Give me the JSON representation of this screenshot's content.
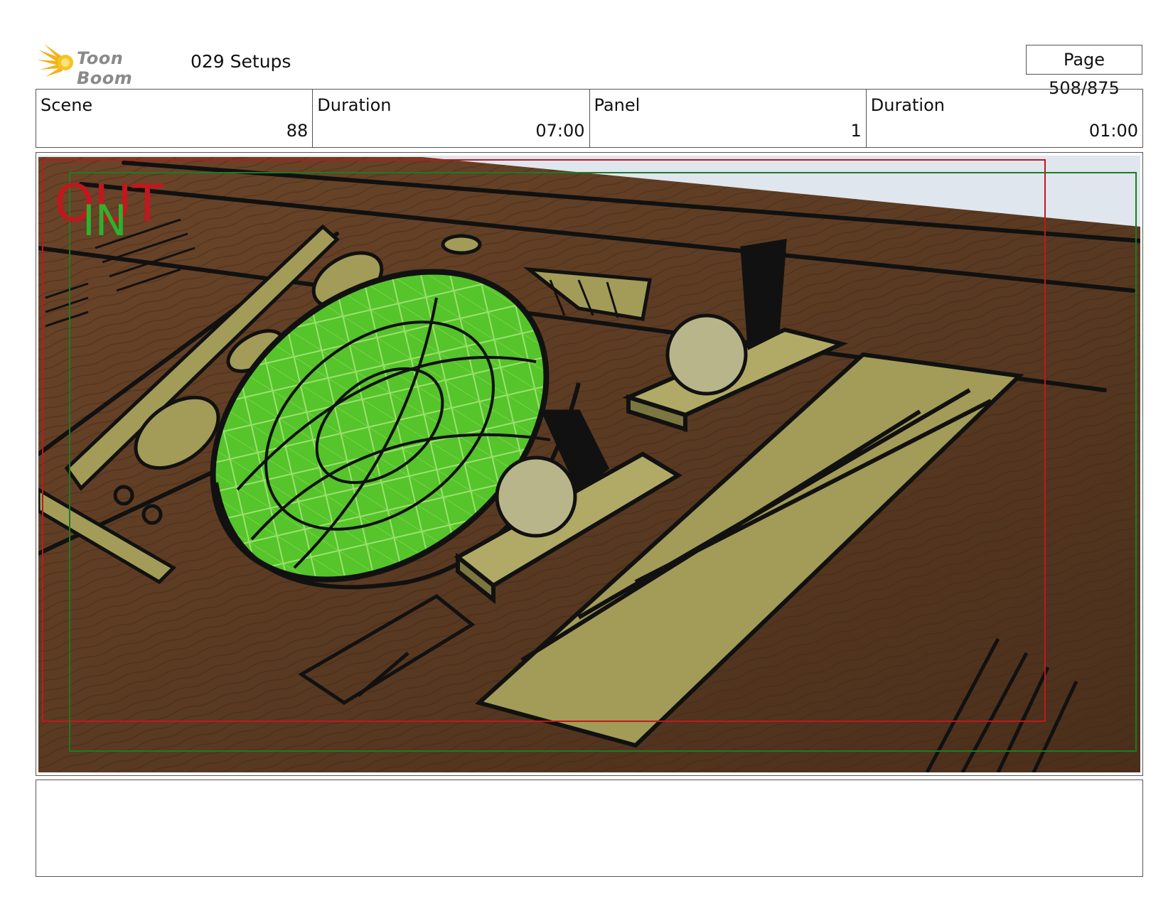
{
  "header": {
    "logo_text": "Toon Boom",
    "title": "029 Setups",
    "page": "Page 508/875"
  },
  "info": {
    "scene_label": "Scene",
    "scene_value": "88",
    "scene_duration_label": "Duration",
    "scene_duration_value": "07:00",
    "panel_label": "Panel",
    "panel_value": "1",
    "panel_duration_label": "Duration",
    "panel_duration_value": "01:00"
  },
  "panel": {
    "out_label": "OUT",
    "in_label": "IN",
    "colors": {
      "wood": "#5a3a22",
      "panel_olive": "#a09a55",
      "screen_green": "#55c22a",
      "outline": "#111111",
      "frame_out": "#c0181e",
      "frame_in": "#1e7a24"
    }
  },
  "notes": {
    "text": ""
  }
}
